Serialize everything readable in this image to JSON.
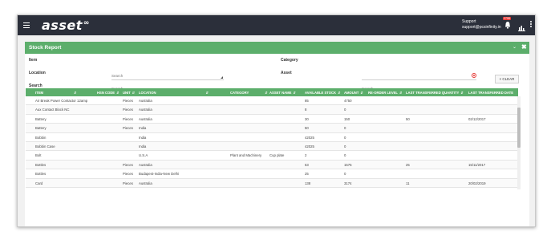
{
  "header": {
    "logo_text": "asset",
    "logo_suffix": "∞",
    "support_label": "Support",
    "support_email": "support@pcsinfinity.in",
    "notification_badge": "2798",
    "accent_color": "#5cae6b",
    "navbar_color": "#2b2f3a",
    "icons": [
      "menu-icon",
      "bell-icon",
      "bar-chart-icon",
      "more-vertical-icon"
    ]
  },
  "panel": {
    "title": "Stock Report",
    "collapse_icon": "chevron-down-icon",
    "close_icon": "close-icon"
  },
  "filters": {
    "item_label": "Item",
    "item_placeholder": "Search",
    "location_label": "Location",
    "location_placeholder": "Search",
    "search_label": "Search",
    "category_label": "Category",
    "asset_label": "Asset",
    "asset_placeholder": "Search",
    "clear_label": "× CLEAR"
  },
  "table": {
    "columns": [
      "ITEM",
      "HSN CODE",
      "UNIT",
      "LOCATION",
      "CATEGORY",
      "ASSET NAME",
      "AVAILABLE STOCK",
      "AMOUNT",
      "RE-ORDER LEVEL",
      "LAST TRANSFERRED QUANTITY",
      "LAST TRANSFERRED DATE"
    ],
    "rows": [
      [
        "Air Break Power Contactor 12amp",
        "",
        "Pieces",
        "Australia",
        "",
        "",
        "85",
        "4750",
        "",
        "",
        ""
      ],
      [
        "Aux Contact Block NC",
        "",
        "Pieces",
        "Australia",
        "",
        "",
        "8",
        "0",
        "",
        "",
        ""
      ],
      [
        "Battery",
        "",
        "Pieces",
        "Australia",
        "",
        "",
        "30",
        "150",
        "",
        "50",
        "02/12/2017"
      ],
      [
        "Battery",
        "",
        "Pieces",
        "India",
        "",
        "",
        "50",
        "0",
        "",
        "",
        ""
      ],
      [
        "Bobbin",
        "",
        "",
        "India",
        "",
        "",
        "42025",
        "0",
        "",
        "",
        ""
      ],
      [
        "Bobbin Case",
        "",
        "",
        "India",
        "",
        "",
        "42025",
        "0",
        "",
        "",
        ""
      ],
      [
        "Bolt",
        "",
        "",
        "U.S.A",
        "Plant and Machinery",
        "Cup plate",
        "2",
        "0",
        "",
        "",
        ""
      ],
      [
        "Bottles",
        "",
        "Pieces",
        "Australia",
        "",
        "",
        "63",
        "1575",
        "",
        "25",
        "15/11/2017"
      ],
      [
        "Bottles",
        "",
        "Pieces",
        "Budapest-India-New Delhi",
        "",
        "",
        "25",
        "0",
        "",
        "",
        ""
      ],
      [
        "Card",
        "",
        "Pieces",
        "Australia",
        "",
        "",
        "138",
        "3174",
        "",
        "11",
        "20/02/2019"
      ],
      [
        "Card",
        "",
        "Pieces",
        "China",
        "",
        "",
        "678",
        "22052",
        "",
        "",
        ""
      ]
    ]
  }
}
